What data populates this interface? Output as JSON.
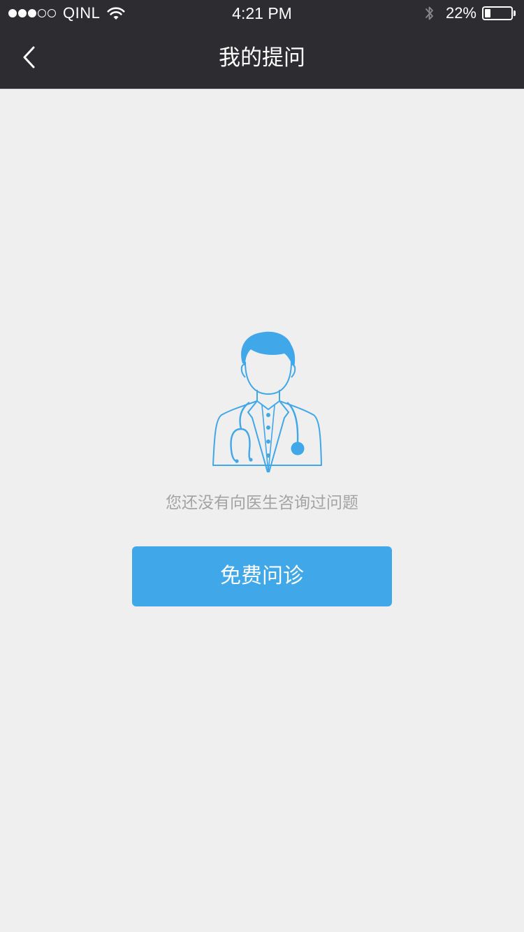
{
  "status_bar": {
    "signal_strength": 3,
    "signal_max": 5,
    "carrier": "QINL",
    "time": "4:21 PM",
    "battery_text": "22%",
    "battery_level": 0.22,
    "icons": [
      "wifi-icon",
      "bluetooth-icon",
      "battery-icon"
    ]
  },
  "nav": {
    "back_icon": "chevron-left-icon",
    "title": "我的提问"
  },
  "empty_state": {
    "illustration_icon": "doctor-icon",
    "message": "您还没有向医生咨询过问题",
    "button_label": "免费问诊"
  },
  "colors": {
    "nav_background": "#2d2c31",
    "page_background": "#efefef",
    "accent_blue": "#40a7e9",
    "muted_text": "#a3a3a3"
  }
}
